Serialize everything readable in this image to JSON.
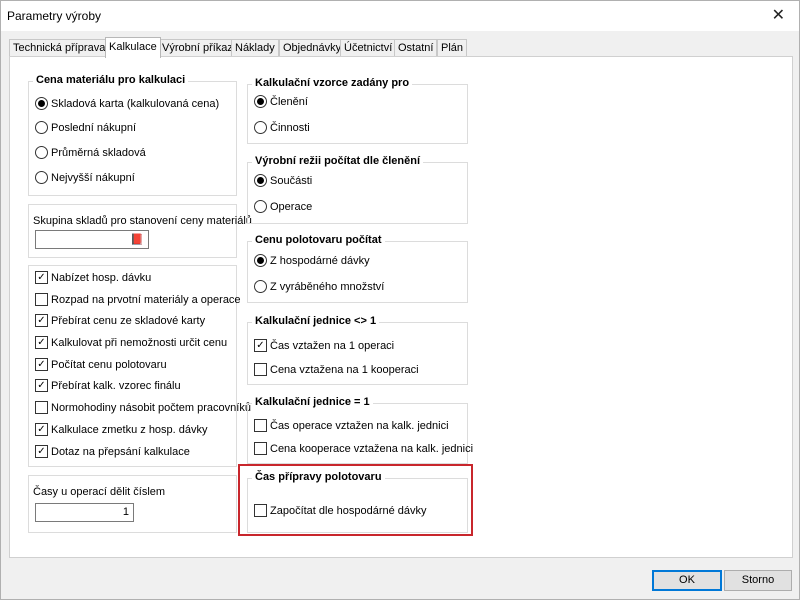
{
  "window": {
    "title": "Parametry výroby"
  },
  "tabs": [
    "Technická příprava",
    "Kalkulace",
    "Výrobní příkazy",
    "Náklady",
    "Objednávky",
    "Účetnictví",
    "Ostatní",
    "Plán"
  ],
  "active_tab": "Kalkulace",
  "material_price": {
    "title": "Cena materiálu pro kalkulaci",
    "options": [
      "Skladová karta (kalkulovaná cena)",
      "Poslední nákupní",
      "Průměrná skladová",
      "Nejvyšší nákupní"
    ],
    "selected": "Skladová karta (kalkulovaná cena)"
  },
  "warehouse_group": {
    "label": "Skupina skladů pro stanovení ceny materiálů",
    "value": "",
    "icon": "book-icon"
  },
  "options_checks": [
    {
      "label": "Nabízet hosp. dávku",
      "checked": true
    },
    {
      "label": "Rozpad na prvotní materiály a operace",
      "checked": false
    },
    {
      "label": "Přebírat cenu ze skladové karty",
      "checked": true
    },
    {
      "label": "Kalkulovat při nemožnosti určit cenu",
      "checked": true
    },
    {
      "label": "Počítat cenu polotovaru",
      "checked": true
    },
    {
      "label": "Přebírat kalk. vzorec finálu",
      "checked": true
    },
    {
      "label": "Normohodiny násobit počtem pracovníků",
      "checked": false
    },
    {
      "label": "Kalkulace zmetku z hosp. dávky",
      "checked": true
    },
    {
      "label": "Dotaz na přepsání kalkulace",
      "checked": true
    }
  ],
  "time_divide": {
    "label": "Časy u operací dělit číslem",
    "value": "1"
  },
  "formula_group": {
    "title": "Kalkulační vzorce zadány pro",
    "options": [
      "Členění",
      "Činnosti"
    ],
    "selected": "Členění"
  },
  "overhead_group": {
    "title": "Výrobní režii počítat dle členění",
    "options": [
      "Součásti",
      "Operace"
    ],
    "selected": "Součásti"
  },
  "semi_price_group": {
    "title": "Cenu polotovaru počítat",
    "options": [
      "Z hospodárné dávky",
      "Z vyráběného množství"
    ],
    "selected": "Z hospodárné dávky"
  },
  "unit_ne1_group": {
    "title": "Kalkulační jednice <> 1",
    "checks": [
      {
        "label": "Čas vztažen na 1 operaci",
        "checked": true
      },
      {
        "label": "Cena vztažena na 1 kooperaci",
        "checked": false
      }
    ]
  },
  "unit_eq1_group": {
    "title": "Kalkulační jednice = 1",
    "checks": [
      {
        "label": "Čas operace vztažen na kalk. jednici",
        "checked": false
      },
      {
        "label": "Cena kooperace vztažena na kalk. jednici",
        "checked": false
      }
    ]
  },
  "prep_time_group": {
    "title": "Čas přípravy polotovaru",
    "checks": [
      {
        "label": "Započítat dle hospodárné dávky",
        "checked": false
      }
    ]
  },
  "buttons": {
    "ok": "OK",
    "cancel": "Storno"
  },
  "colors": {
    "highlight": "#c8262c",
    "default_button_border": "#0078d7"
  }
}
